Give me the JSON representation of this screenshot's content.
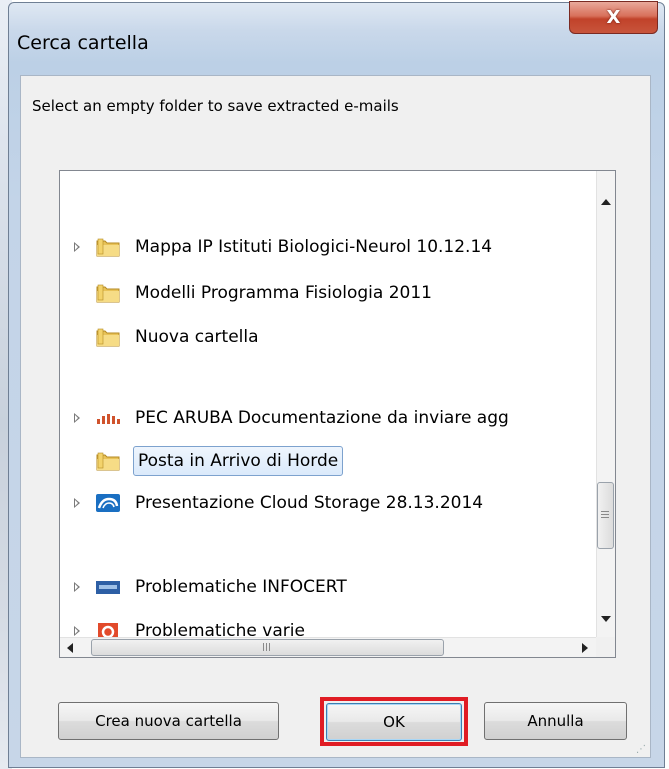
{
  "window": {
    "title": "Cerca cartella",
    "close_label": "X"
  },
  "instruction": "Select an empty folder to save extracted e-mails",
  "tree": {
    "items": [
      {
        "label": "Mappa IP Istituti Biologici-Neurol  10.12.14",
        "icon": "folder-icon",
        "expandable": true,
        "selected": false
      },
      {
        "label": "Modelli Programma Fisiologia 2011",
        "icon": "folder-icon",
        "expandable": false,
        "selected": false
      },
      {
        "label": "Nuova cartella",
        "icon": "folder-icon",
        "expandable": false,
        "selected": false
      },
      {
        "label": "PEC ARUBA Documentazione da inviare agg",
        "icon": "aruba-logo-icon",
        "expandable": true,
        "selected": false
      },
      {
        "label": "Posta in Arrivo di Horde",
        "icon": "folder-icon",
        "expandable": false,
        "selected": true
      },
      {
        "label": "Presentazione Cloud Storage 28.13.2014",
        "icon": "cloud-icon",
        "expandable": true,
        "selected": false
      },
      {
        "label": "Problematiche INFOCERT",
        "icon": "infocert-icon",
        "expandable": true,
        "selected": false
      },
      {
        "label": "Problematiche varie",
        "icon": "office-icon",
        "expandable": true,
        "selected": false
      }
    ]
  },
  "buttons": {
    "new_folder": "Crea nuova cartella",
    "ok": "OK",
    "cancel": "Annulla"
  },
  "colors": {
    "highlight": "#e01c24",
    "selection": "#dbeafb",
    "close": "#c1422a"
  }
}
